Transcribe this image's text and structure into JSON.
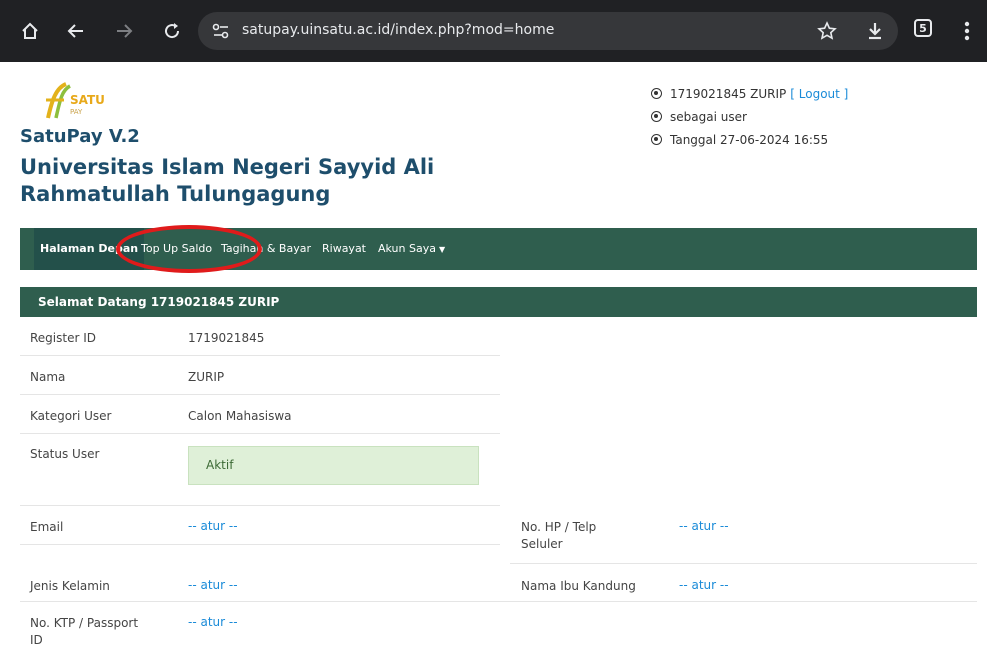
{
  "browser": {
    "url": "satupay.uinsatu.ac.id/index.php?mod=home",
    "tab_count": "5"
  },
  "header": {
    "logo_text": "SATU PAY",
    "app_name": "SatuPay V.2",
    "university": "Universitas Islam Negeri Sayyid Ali Rahmatullah Tulungagung",
    "user_line": "1719021845 ZURIP",
    "logout_label": "[ Logout ]",
    "role_line": "sebagai user",
    "date_line": "Tanggal 27-06-2024 16:55"
  },
  "nav": {
    "items": [
      {
        "label": "Halaman Depan"
      },
      {
        "label": "Top Up Saldo"
      },
      {
        "label": "Tagihan & Bayar"
      },
      {
        "label": "Riwayat"
      },
      {
        "label": "Akun Saya"
      }
    ]
  },
  "welcome": "Selamat Datang 1719021845 ZURIP",
  "profile": {
    "register_id_label": "Register ID",
    "register_id_value": "1719021845",
    "nama_label": "Nama",
    "nama_value": "ZURIP",
    "kategori_label": "Kategori User",
    "kategori_value": "Calon Mahasiswa",
    "status_label": "Status User",
    "status_value": "Aktif",
    "email_label": "Email",
    "email_value": "-- atur --",
    "hp_label_1": "No. HP / Telp",
    "hp_label_2": "Seluler",
    "hp_value": "-- atur --",
    "jk_label": "Jenis Kelamin",
    "jk_value": "-- atur --",
    "ibu_label": "Nama Ibu Kandung",
    "ibu_value": "-- atur --",
    "ktp_label_1": "No. KTP / Passport",
    "ktp_label_2": "ID",
    "ktp_value": "-- atur --"
  },
  "colors": {
    "navbar": "#2f5e4e",
    "title": "#1e4e6c",
    "link": "#1a8bd8",
    "status_bg": "#dff0d8",
    "highlight": "#e01b1b"
  }
}
